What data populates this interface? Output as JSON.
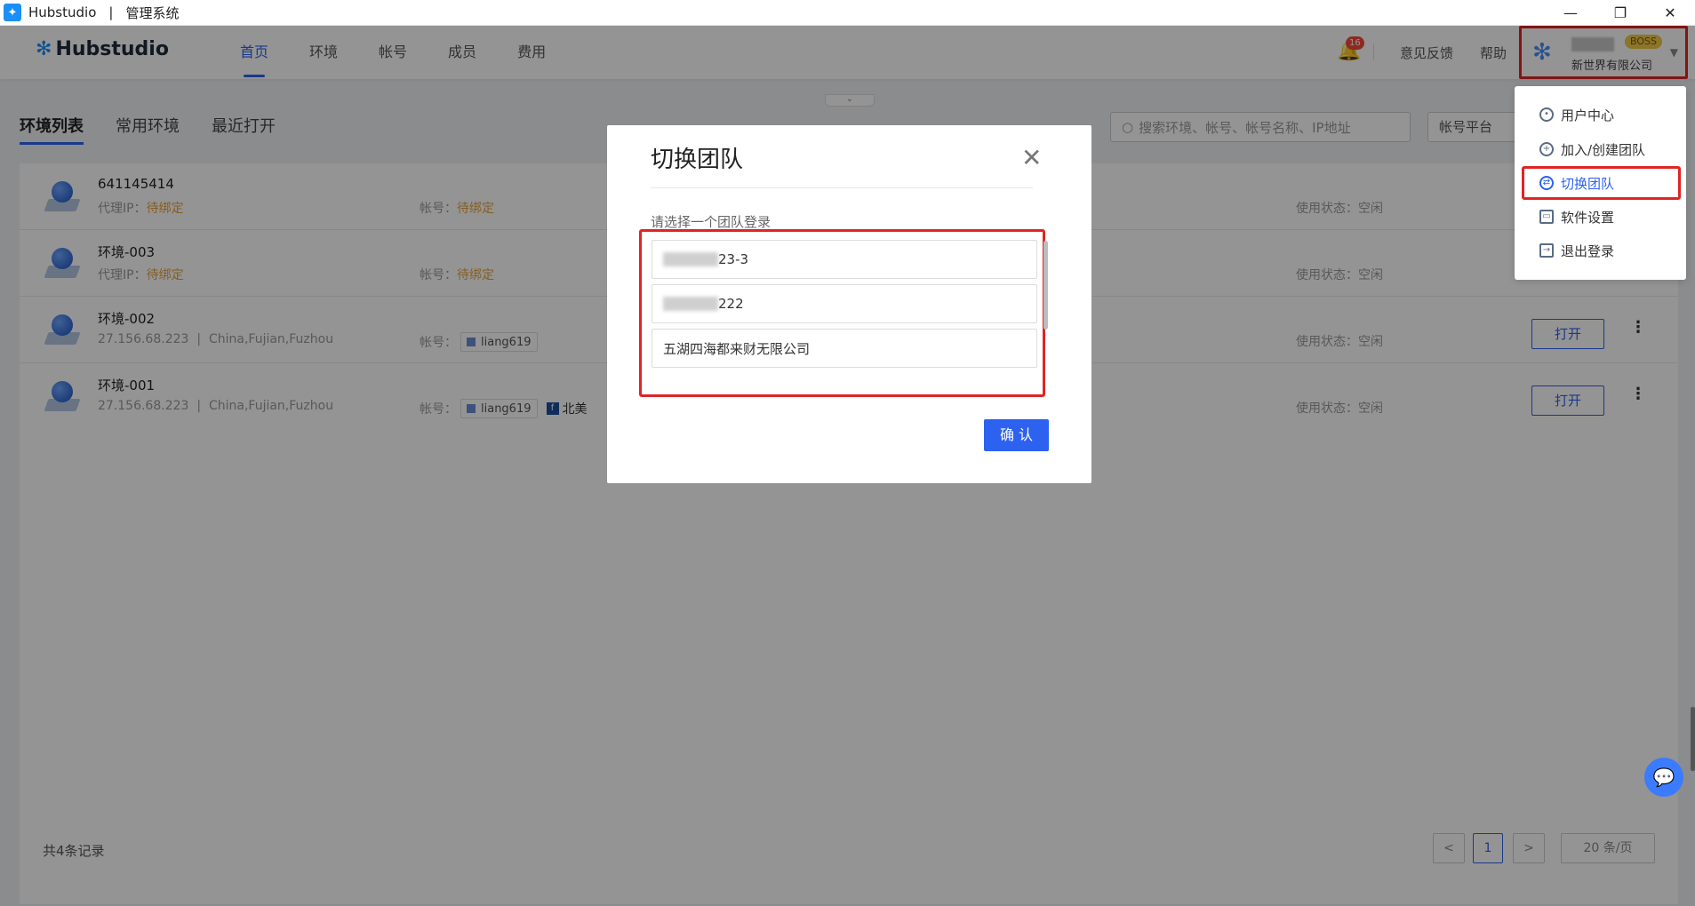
{
  "window": {
    "app_name": "Hubstudio",
    "separator": "|",
    "subtitle": "管理系统",
    "minimize": "—",
    "maximize": "❐",
    "close": "✕"
  },
  "header": {
    "logo_text": "Hubstudio",
    "nav": [
      "首页",
      "环境",
      "帐号",
      "成员",
      "费用"
    ],
    "notifications": "16",
    "feedback": "意见反馈",
    "help": "帮助",
    "user_badge": "BOSS",
    "company": "新世界有限公司"
  },
  "toolbar": {
    "tabs": [
      "环境列表",
      "常用环境",
      "最近打开"
    ],
    "search_placeholder": "搜索环境、帐号、帐号名称、IP地址",
    "platform_filter": "帐号平台"
  },
  "table": {
    "proxy_label": "代理IP：",
    "account_label": "帐号：",
    "status_label": "使用状态：",
    "rows": [
      {
        "name": "641145414",
        "proxy": "待绑定",
        "account": "待绑定",
        "status": "空闲"
      },
      {
        "name": "环境-003",
        "proxy": "待绑定",
        "account": "待绑定",
        "status": "空闲"
      },
      {
        "name": "环境-002",
        "ip": "27.156.68.223",
        "location": "China,Fujian,Fuzhou",
        "account": "liang619",
        "status": "空闲",
        "open": "打开"
      },
      {
        "name": "环境-001",
        "ip": "27.156.68.223",
        "location": "China,Fujian,Fuzhou",
        "account": "liang619",
        "account2": "北美",
        "status": "空闲",
        "open": "打开"
      }
    ]
  },
  "footer": {
    "total": "共4条记录",
    "prev": "<",
    "page": "1",
    "next": ">",
    "page_size": "20 条/页"
  },
  "dialog": {
    "title": "切换团队",
    "close": "✕",
    "label": "请选择一个团队登录",
    "teams": [
      "23-3",
      "222",
      "五湖四海都来财无限公司"
    ],
    "confirm": "确 认"
  },
  "user_menu": {
    "items": [
      "用户中心",
      "加入/创建团队",
      "切换团队",
      "软件设置",
      "退出登录"
    ],
    "active": "切换团队"
  },
  "colors": {
    "primary": "#2d62f0",
    "highlight_border": "#e02424",
    "warning": "#e6a23c"
  }
}
